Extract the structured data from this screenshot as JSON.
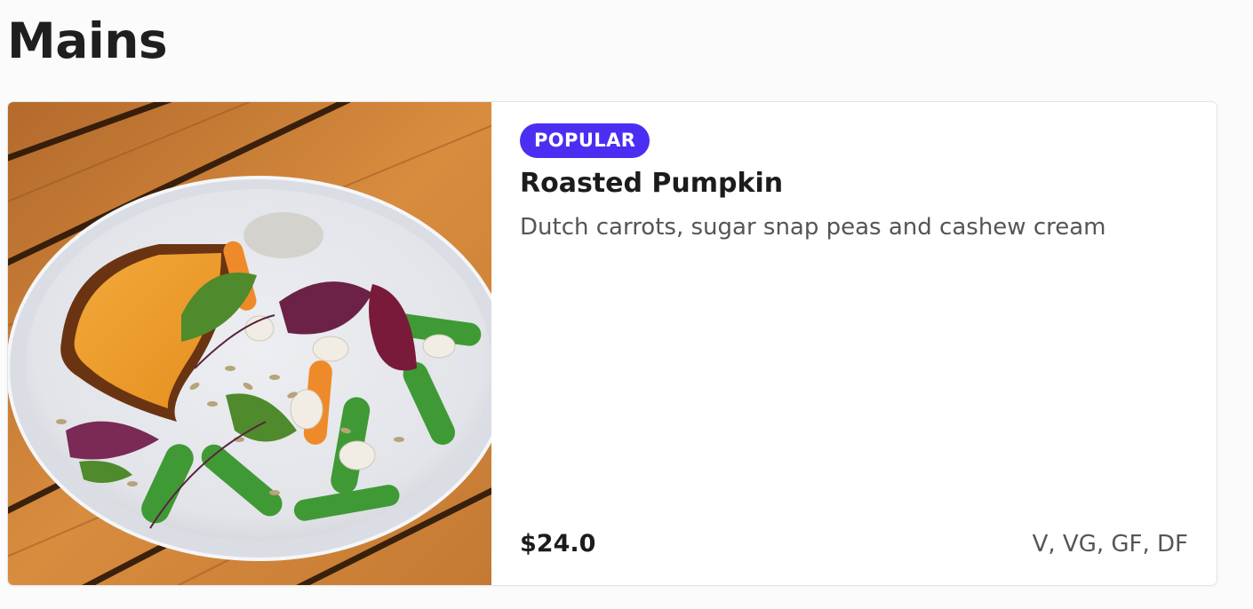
{
  "section": {
    "title": "Mains"
  },
  "menu_item": {
    "badge": "POPULAR",
    "name": "Roasted Pumpkin",
    "description": "Dutch carrots, sugar snap peas and cashew cream",
    "price": "$24.0",
    "dietary": "V, VG, GF, DF",
    "image_alt": "Roasted Pumpkin"
  },
  "colors": {
    "badge_bg": "#4a2ff2",
    "page_bg": "#fbfbfb",
    "card_bg": "#ffffff",
    "text_primary": "#1c1c1c",
    "text_secondary": "#555555"
  }
}
